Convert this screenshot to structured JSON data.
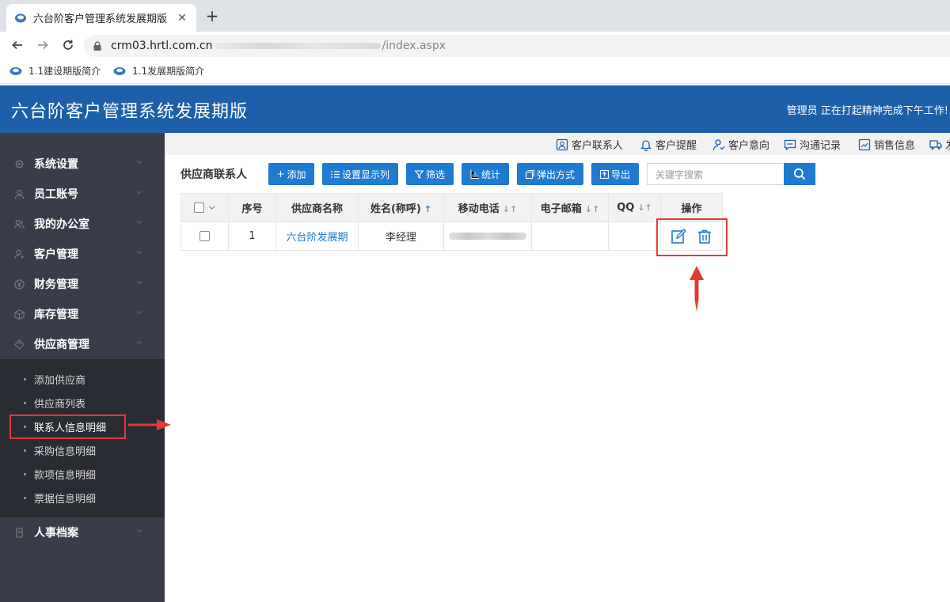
{
  "browser": {
    "tab_title": "六台阶客户管理系统发展期版",
    "tab_close": "✕",
    "new_tab": "+",
    "url_host": "crm03.hrtl.com.cn",
    "url_path": "/index.aspx",
    "bookmarks": [
      "1.1建设期版简介",
      "1.1发展期版简介"
    ]
  },
  "header": {
    "title": "六台阶客户管理系统发展期版",
    "greeting": "管理员 正在打起精神完成下午工作!"
  },
  "sidebar": {
    "items": [
      {
        "label": "系统设置",
        "icon": "gear-icon"
      },
      {
        "label": "员工账号",
        "icon": "user-icon"
      },
      {
        "label": "我的办公室",
        "icon": "users-icon"
      },
      {
        "label": "客户管理",
        "icon": "customer-icon"
      },
      {
        "label": "财务管理",
        "icon": "yen-icon"
      },
      {
        "label": "库存管理",
        "icon": "box-icon"
      },
      {
        "label": "供应商管理",
        "icon": "tag-icon"
      }
    ],
    "submenu": [
      "添加供应商",
      "供应商列表",
      "联系人信息明细",
      "采购信息明细",
      "款项信息明细",
      "票据信息明细"
    ],
    "last_item": {
      "label": "人事档案",
      "icon": "file-icon"
    }
  },
  "quicknav": [
    "客户联系人",
    "客户提醒",
    "客户意向",
    "沟通记录",
    "销售信息",
    "发"
  ],
  "page": {
    "title": "供应商联系人",
    "buttons": {
      "add": "添加",
      "columns": "设置显示列",
      "filter": "筛选",
      "stats": "统计",
      "popup": "弹出方式",
      "export": "导出"
    },
    "search_placeholder": "关键字搜索"
  },
  "table": {
    "headers": [
      "序号",
      "供应商名称",
      "姓名(称呼)",
      "移动电话",
      "电子邮箱",
      "QQ",
      "操作"
    ],
    "rows": [
      {
        "index": "1",
        "supplier": "六台阶发展期",
        "name": "李经理",
        "mobile": "",
        "email": "",
        "qq": ""
      }
    ]
  },
  "colors": {
    "header_bg": "#1e5fa9",
    "sidebar_bg": "#393d49",
    "submenu_bg": "#2a2c33",
    "primary": "#1e7bd1",
    "annotation_red": "#e53935"
  }
}
